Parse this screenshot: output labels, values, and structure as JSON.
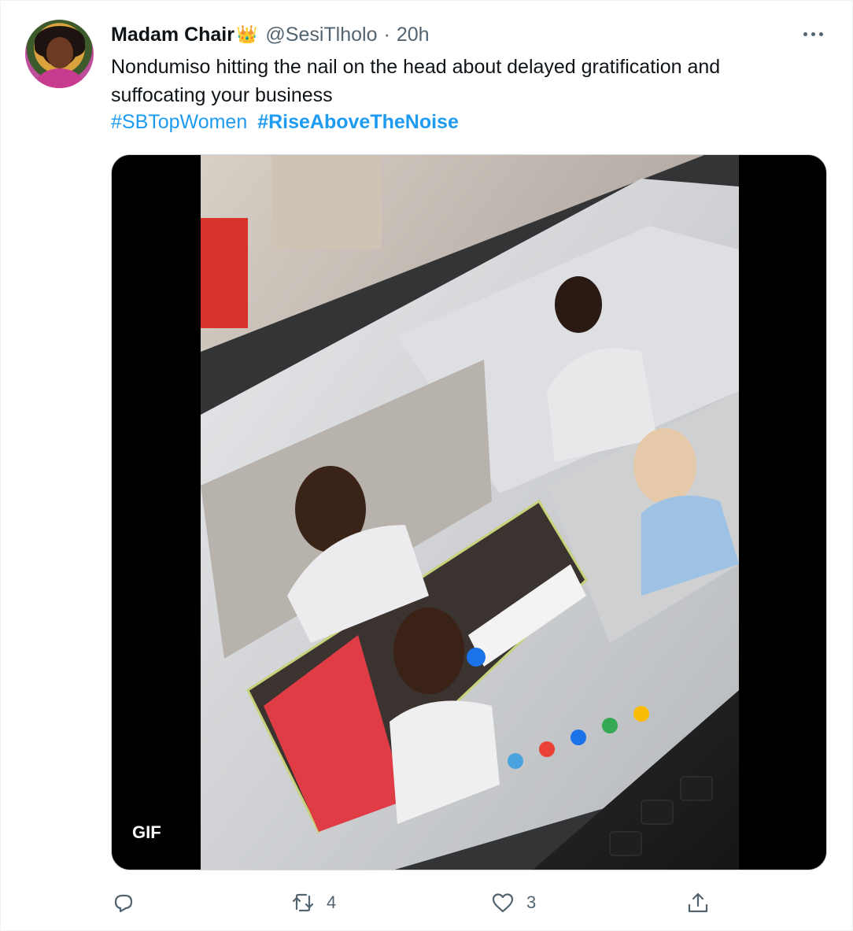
{
  "tweet": {
    "author": {
      "display_name": "Madam Chair",
      "badge_emoji": "👑",
      "handle": "@SesiTlholo",
      "separator": "·",
      "time": "20h"
    },
    "text": "Nondumiso hitting the nail on the head about delayed gratification and suffocating your business",
    "hashtags": [
      "#SBTopWomen",
      "#RiseAboveTheNoise"
    ],
    "media": {
      "badge": "GIF"
    },
    "actions": {
      "reply_count": "",
      "retweet_count": "4",
      "like_count": "3"
    }
  },
  "icons": {
    "more": "more-horizontal-icon",
    "reply": "reply-icon",
    "retweet": "retweet-icon",
    "like": "heart-icon",
    "share": "share-icon"
  },
  "colors": {
    "link": "#1d9bf0",
    "secondary_text": "#536471",
    "primary_text": "#0f1419"
  }
}
